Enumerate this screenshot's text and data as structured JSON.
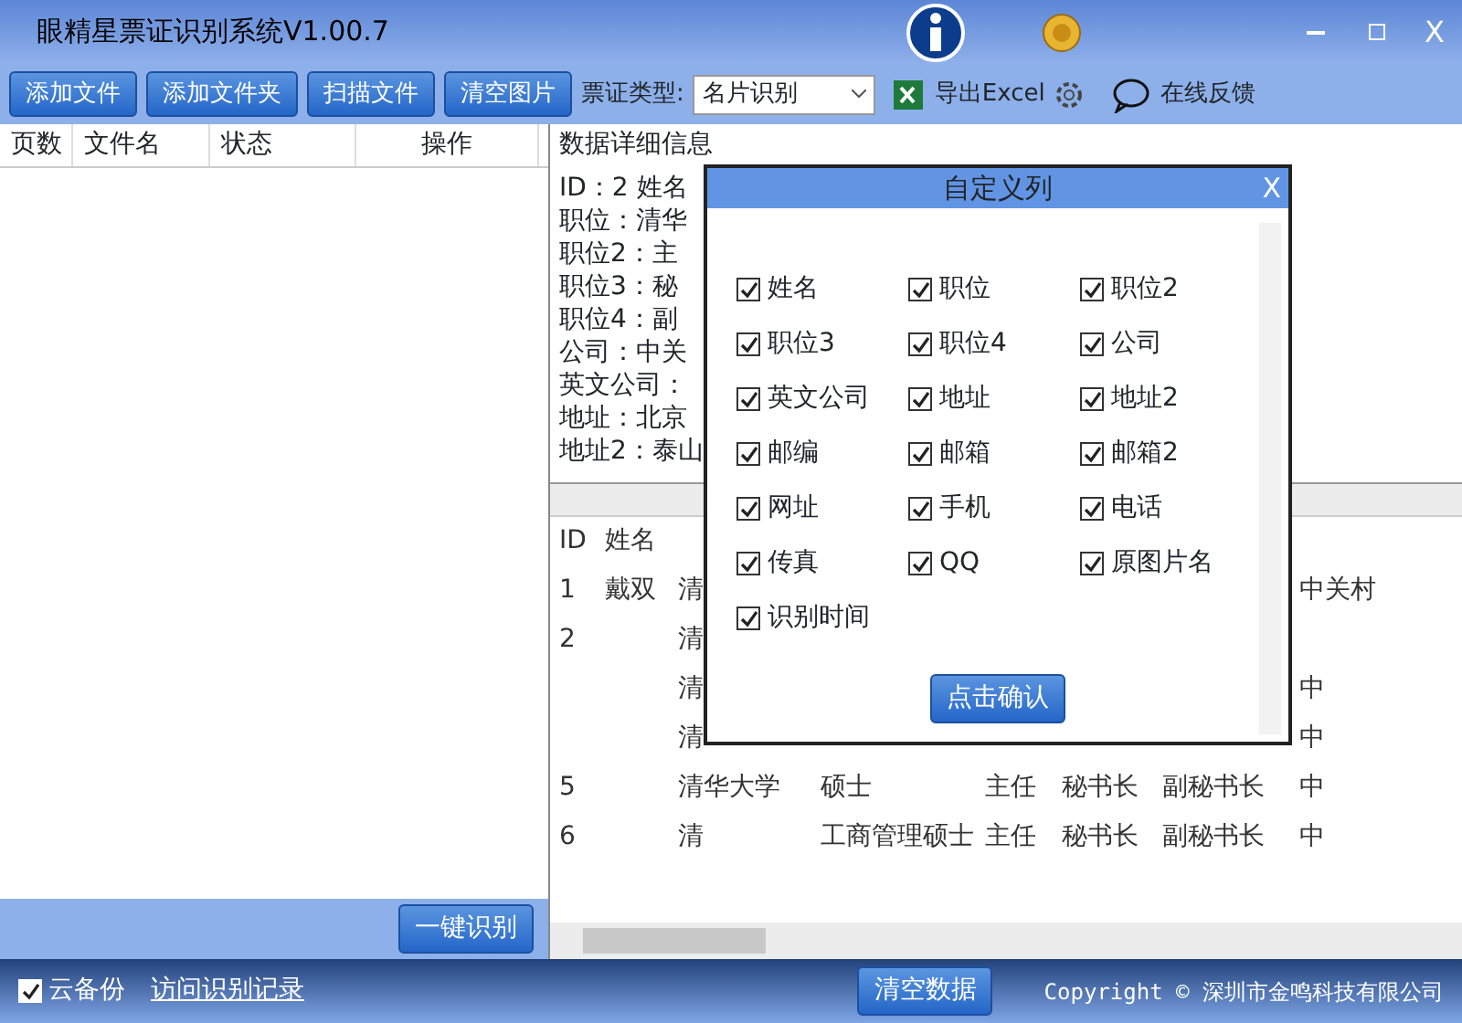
{
  "window": {
    "title": "眼精星票证识别系统V1.00.7",
    "close": "X"
  },
  "toolbar": {
    "buttons": [
      "添加文件",
      "添加文件夹",
      "扫描文件",
      "清空图片"
    ],
    "ticket_type": {
      "label": "票证类型:",
      "value": "名片识别"
    },
    "export": "导出Excel",
    "feedback": "在线反馈"
  },
  "file_list": {
    "columns": [
      "页数",
      "文件名",
      "状态",
      "操作"
    ],
    "action": "一键识别"
  },
  "details": {
    "title": "数据详细信息",
    "lines": [
      "ID：2 姓名",
      "职位：清华",
      "职位2：主",
      "职位3：秘",
      "职位4：副",
      "公司：中关",
      "英文公司：",
      "地址：北京",
      "地址2：泰山"
    ]
  },
  "results": {
    "columns": [
      "ID",
      "姓名"
    ],
    "rows": [
      [
        "1",
        "戴双",
        "清",
        "",
        "",
        "",
        "",
        "中关村"
      ],
      [
        "2",
        "",
        "清",
        "",
        "",
        "",
        "",
        ""
      ],
      [
        "",
        "",
        "清",
        "",
        "",
        "",
        "",
        "中"
      ],
      [
        "",
        "",
        "清",
        "",
        "",
        "",
        "",
        "中"
      ],
      [
        "5",
        "",
        "清华大学",
        "硕士",
        "主任",
        "秘书长",
        "副秘书长",
        "中"
      ],
      [
        "6",
        "",
        "清",
        "工商管理硕士",
        "主任",
        "秘书长",
        "副秘书长",
        "中"
      ]
    ]
  },
  "dialog": {
    "title": "自定义列",
    "close": "X",
    "options": [
      {
        "label": "姓名",
        "checked": true
      },
      {
        "label": "职位",
        "checked": true
      },
      {
        "label": "职位2",
        "checked": true
      },
      {
        "label": "职位3",
        "checked": true
      },
      {
        "label": "职位4",
        "checked": true
      },
      {
        "label": "公司",
        "checked": true
      },
      {
        "label": "英文公司",
        "checked": true
      },
      {
        "label": "地址",
        "checked": true
      },
      {
        "label": "地址2",
        "checked": true
      },
      {
        "label": "邮编",
        "checked": true
      },
      {
        "label": "邮箱",
        "checked": true
      },
      {
        "label": "邮箱2",
        "checked": true
      },
      {
        "label": "网址",
        "checked": true
      },
      {
        "label": "手机",
        "checked": true
      },
      {
        "label": "电话",
        "checked": true
      },
      {
        "label": "传真",
        "checked": true
      },
      {
        "label": "QQ",
        "checked": true
      },
      {
        "label": "原图片名",
        "checked": true
      },
      {
        "label": "识别时间",
        "checked": true
      }
    ],
    "confirm": "点击确认"
  },
  "footer": {
    "cloud_backup": {
      "label": "云备份",
      "checked": true
    },
    "history_link": "访问识别记录",
    "clear": "清空数据",
    "copyright": "Copyright © 深圳市金鸣科技有限公司"
  }
}
